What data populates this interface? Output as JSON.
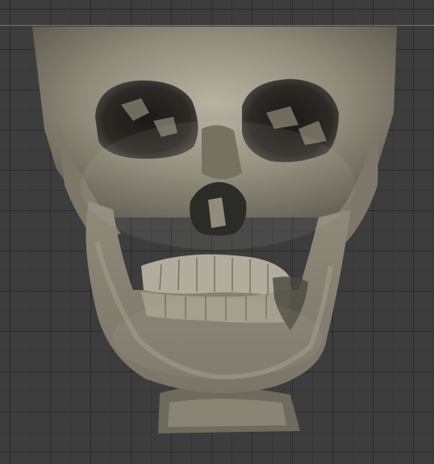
{
  "viewport": {
    "grid_color": "#2c2c2c",
    "background_color": "#3d3d3d",
    "axis_color": "#b5646f"
  },
  "model": {
    "icon": "skull-3d-model-icon",
    "bone_color": "#8c8776",
    "shadow_color": "#1a1a18"
  }
}
